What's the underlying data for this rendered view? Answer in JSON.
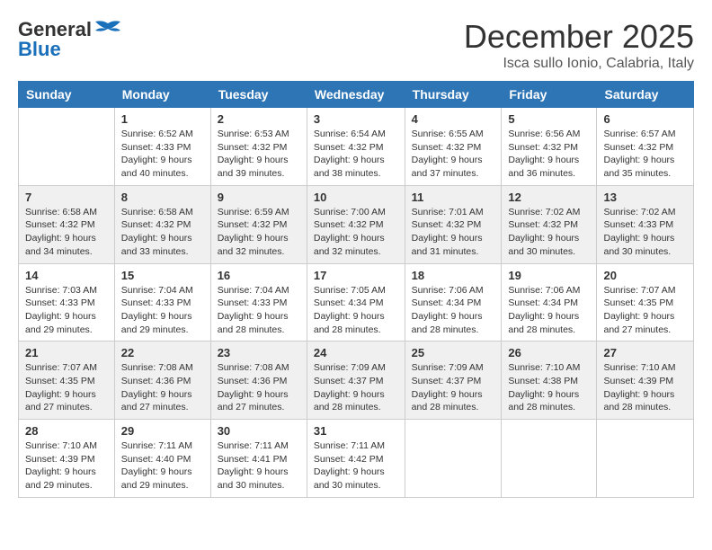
{
  "logo": {
    "general": "General",
    "blue": "Blue"
  },
  "header": {
    "month": "December 2025",
    "location": "Isca sullo Ionio, Calabria, Italy"
  },
  "weekdays": [
    "Sunday",
    "Monday",
    "Tuesday",
    "Wednesday",
    "Thursday",
    "Friday",
    "Saturday"
  ],
  "weeks": [
    [
      {
        "day": "",
        "info": ""
      },
      {
        "day": "1",
        "info": "Sunrise: 6:52 AM\nSunset: 4:33 PM\nDaylight: 9 hours\nand 40 minutes."
      },
      {
        "day": "2",
        "info": "Sunrise: 6:53 AM\nSunset: 4:32 PM\nDaylight: 9 hours\nand 39 minutes."
      },
      {
        "day": "3",
        "info": "Sunrise: 6:54 AM\nSunset: 4:32 PM\nDaylight: 9 hours\nand 38 minutes."
      },
      {
        "day": "4",
        "info": "Sunrise: 6:55 AM\nSunset: 4:32 PM\nDaylight: 9 hours\nand 37 minutes."
      },
      {
        "day": "5",
        "info": "Sunrise: 6:56 AM\nSunset: 4:32 PM\nDaylight: 9 hours\nand 36 minutes."
      },
      {
        "day": "6",
        "info": "Sunrise: 6:57 AM\nSunset: 4:32 PM\nDaylight: 9 hours\nand 35 minutes."
      }
    ],
    [
      {
        "day": "7",
        "info": "Sunrise: 6:58 AM\nSunset: 4:32 PM\nDaylight: 9 hours\nand 34 minutes."
      },
      {
        "day": "8",
        "info": "Sunrise: 6:58 AM\nSunset: 4:32 PM\nDaylight: 9 hours\nand 33 minutes."
      },
      {
        "day": "9",
        "info": "Sunrise: 6:59 AM\nSunset: 4:32 PM\nDaylight: 9 hours\nand 32 minutes."
      },
      {
        "day": "10",
        "info": "Sunrise: 7:00 AM\nSunset: 4:32 PM\nDaylight: 9 hours\nand 32 minutes."
      },
      {
        "day": "11",
        "info": "Sunrise: 7:01 AM\nSunset: 4:32 PM\nDaylight: 9 hours\nand 31 minutes."
      },
      {
        "day": "12",
        "info": "Sunrise: 7:02 AM\nSunset: 4:32 PM\nDaylight: 9 hours\nand 30 minutes."
      },
      {
        "day": "13",
        "info": "Sunrise: 7:02 AM\nSunset: 4:33 PM\nDaylight: 9 hours\nand 30 minutes."
      }
    ],
    [
      {
        "day": "14",
        "info": "Sunrise: 7:03 AM\nSunset: 4:33 PM\nDaylight: 9 hours\nand 29 minutes."
      },
      {
        "day": "15",
        "info": "Sunrise: 7:04 AM\nSunset: 4:33 PM\nDaylight: 9 hours\nand 29 minutes."
      },
      {
        "day": "16",
        "info": "Sunrise: 7:04 AM\nSunset: 4:33 PM\nDaylight: 9 hours\nand 28 minutes."
      },
      {
        "day": "17",
        "info": "Sunrise: 7:05 AM\nSunset: 4:34 PM\nDaylight: 9 hours\nand 28 minutes."
      },
      {
        "day": "18",
        "info": "Sunrise: 7:06 AM\nSunset: 4:34 PM\nDaylight: 9 hours\nand 28 minutes."
      },
      {
        "day": "19",
        "info": "Sunrise: 7:06 AM\nSunset: 4:34 PM\nDaylight: 9 hours\nand 28 minutes."
      },
      {
        "day": "20",
        "info": "Sunrise: 7:07 AM\nSunset: 4:35 PM\nDaylight: 9 hours\nand 27 minutes."
      }
    ],
    [
      {
        "day": "21",
        "info": "Sunrise: 7:07 AM\nSunset: 4:35 PM\nDaylight: 9 hours\nand 27 minutes."
      },
      {
        "day": "22",
        "info": "Sunrise: 7:08 AM\nSunset: 4:36 PM\nDaylight: 9 hours\nand 27 minutes."
      },
      {
        "day": "23",
        "info": "Sunrise: 7:08 AM\nSunset: 4:36 PM\nDaylight: 9 hours\nand 27 minutes."
      },
      {
        "day": "24",
        "info": "Sunrise: 7:09 AM\nSunset: 4:37 PM\nDaylight: 9 hours\nand 28 minutes."
      },
      {
        "day": "25",
        "info": "Sunrise: 7:09 AM\nSunset: 4:37 PM\nDaylight: 9 hours\nand 28 minutes."
      },
      {
        "day": "26",
        "info": "Sunrise: 7:10 AM\nSunset: 4:38 PM\nDaylight: 9 hours\nand 28 minutes."
      },
      {
        "day": "27",
        "info": "Sunrise: 7:10 AM\nSunset: 4:39 PM\nDaylight: 9 hours\nand 28 minutes."
      }
    ],
    [
      {
        "day": "28",
        "info": "Sunrise: 7:10 AM\nSunset: 4:39 PM\nDaylight: 9 hours\nand 29 minutes."
      },
      {
        "day": "29",
        "info": "Sunrise: 7:11 AM\nSunset: 4:40 PM\nDaylight: 9 hours\nand 29 minutes."
      },
      {
        "day": "30",
        "info": "Sunrise: 7:11 AM\nSunset: 4:41 PM\nDaylight: 9 hours\nand 30 minutes."
      },
      {
        "day": "31",
        "info": "Sunrise: 7:11 AM\nSunset: 4:42 PM\nDaylight: 9 hours\nand 30 minutes."
      },
      {
        "day": "",
        "info": ""
      },
      {
        "day": "",
        "info": ""
      },
      {
        "day": "",
        "info": ""
      }
    ]
  ]
}
